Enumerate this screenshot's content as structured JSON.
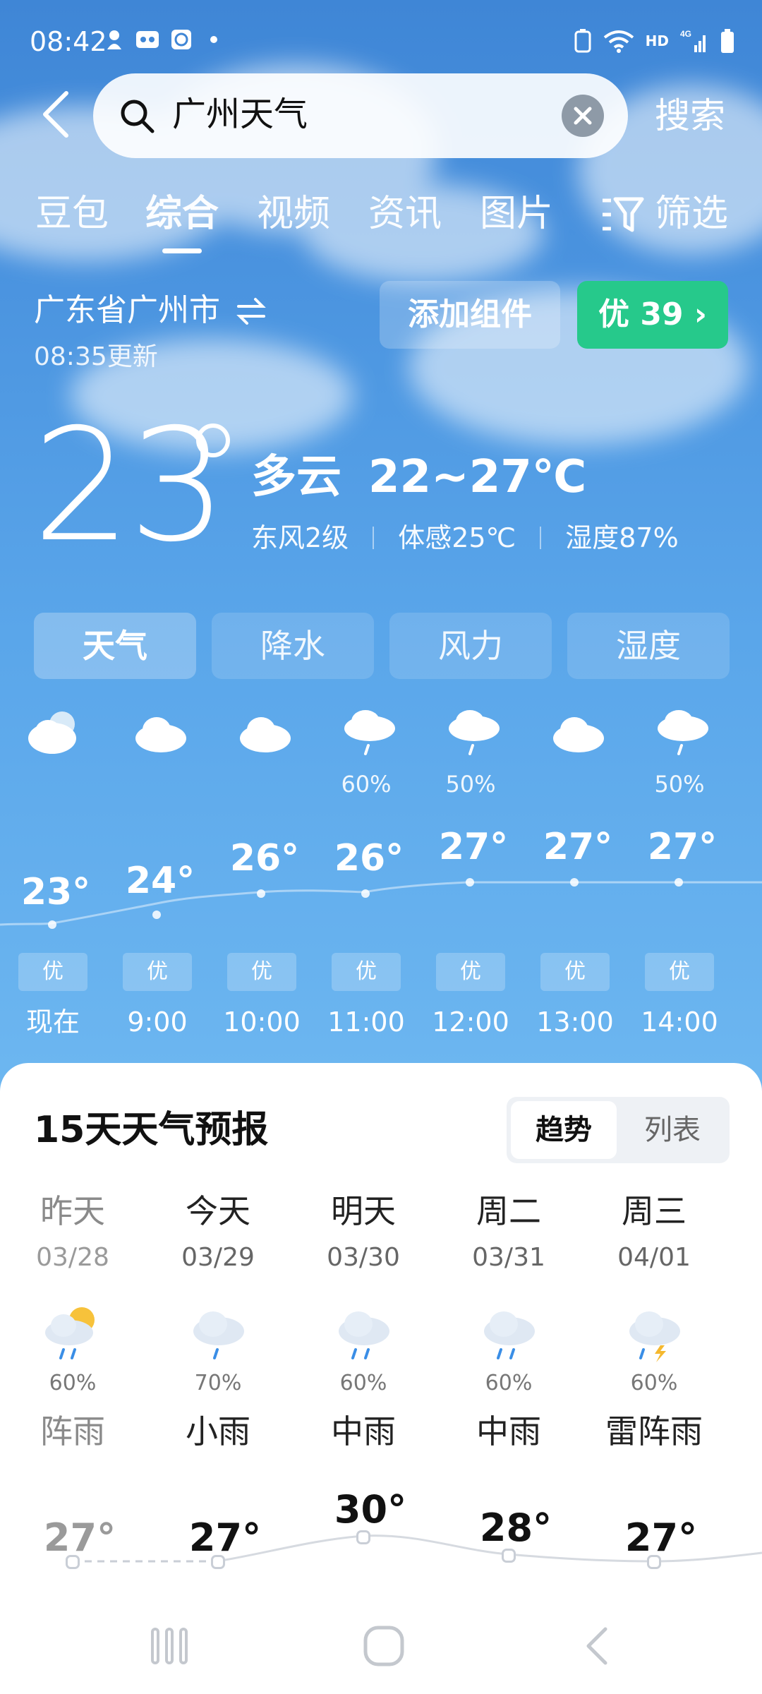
{
  "status_bar": {
    "time": "08:42",
    "network": "4G",
    "hd": "HD"
  },
  "search": {
    "query": "广州天气",
    "button_label": "搜索"
  },
  "tabs": {
    "items": [
      "豆包",
      "综合",
      "视频",
      "资讯",
      "图片",
      "筛选"
    ],
    "active": "综合"
  },
  "location": {
    "name": "广东省广州市",
    "updated": "08:35更新",
    "add_widget": "添加组件",
    "aqi_label": "优 39 ›"
  },
  "current": {
    "temp": "23",
    "condition": "多云",
    "range": "22~27℃",
    "wind": "东风2级",
    "feels": "体感25℃",
    "humidity": "湿度87%"
  },
  "segments": {
    "items": [
      "天气",
      "降水",
      "风力",
      "湿度"
    ],
    "active": "天气"
  },
  "hourly": [
    {
      "time": "现在",
      "temp": "23°",
      "prob": "",
      "quality": "优",
      "icon": "partly-cloudy-icon"
    },
    {
      "time": "9:00",
      "temp": "24°",
      "prob": "",
      "quality": "优",
      "icon": "cloud-icon"
    },
    {
      "time": "10:00",
      "temp": "26°",
      "prob": "",
      "quality": "优",
      "icon": "cloud-icon"
    },
    {
      "time": "11:00",
      "temp": "26°",
      "prob": "60%",
      "quality": "优",
      "icon": "light-rain-icon"
    },
    {
      "time": "12:00",
      "temp": "27°",
      "prob": "50%",
      "quality": "优",
      "icon": "light-rain-icon"
    },
    {
      "time": "13:00",
      "temp": "27°",
      "prob": "",
      "quality": "优",
      "icon": "cloud-icon"
    },
    {
      "time": "14:00",
      "temp": "27°",
      "prob": "50%",
      "quality": "优",
      "icon": "light-rain-icon"
    }
  ],
  "forecast": {
    "title": "15天天气预报",
    "toggle": {
      "trend": "趋势",
      "list": "列表"
    },
    "days": [
      {
        "day": "昨天",
        "date": "03/28",
        "prob": "60%",
        "condition": "阵雨",
        "high": "27°",
        "icon": "sun-rain-icon"
      },
      {
        "day": "今天",
        "date": "03/29",
        "prob": "70%",
        "condition": "小雨",
        "high": "27°",
        "icon": "light-rain-icon"
      },
      {
        "day": "明天",
        "date": "03/30",
        "prob": "60%",
        "condition": "中雨",
        "high": "30°",
        "icon": "moderate-rain-icon"
      },
      {
        "day": "周二",
        "date": "03/31",
        "prob": "60%",
        "condition": "中雨",
        "high": "28°",
        "icon": "moderate-rain-icon"
      },
      {
        "day": "周三",
        "date": "04/01",
        "prob": "60%",
        "condition": "雷阵雨",
        "high": "27°",
        "icon": "thunder-rain-icon"
      }
    ]
  }
}
